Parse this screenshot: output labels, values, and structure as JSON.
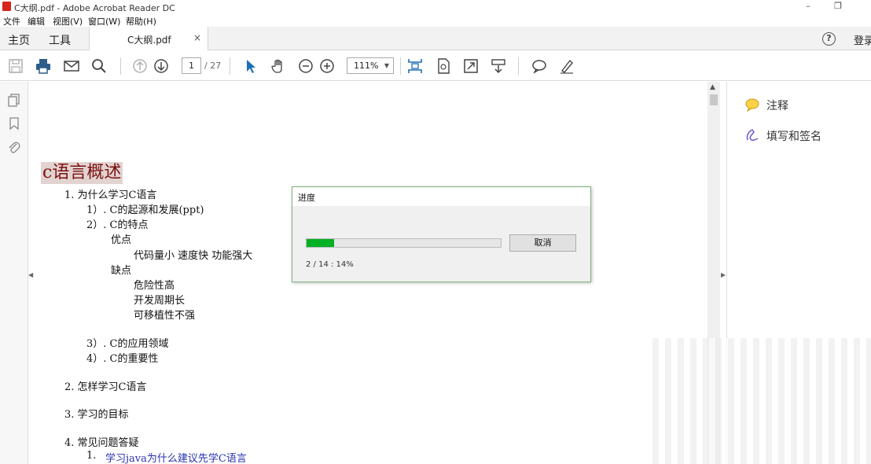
{
  "window": {
    "title": "C大纲.pdf - Adobe Acrobat Reader DC",
    "minimize": "–",
    "restore": "❐"
  },
  "menu": [
    "文件",
    "编辑",
    "视图(V)",
    "窗口(W)",
    "帮助(H)"
  ],
  "tabs": {
    "home": "主页",
    "tools": "工具",
    "document": "C大纲.pdf",
    "close": "×",
    "help": "?",
    "login": "登录"
  },
  "toolbar": {
    "page_current": "1",
    "page_total": "/ 27",
    "zoom": "111%",
    "zoom_caret": "▼"
  },
  "document": {
    "heading": "c语言概述",
    "lines": [
      "1.  为什么学习C语言",
      "1）. C的起源和发展(ppt)",
      "2）. C的特点",
      "优点",
      "代码量小      速度快      功能强大",
      "缺点",
      "危险性高",
      "开发周期长",
      "可移植性不强",
      "3）. C的应用领域",
      "4）. C的重要性",
      "2.  怎样学习C语言",
      "3.  学习的目标",
      "4.  常见问题答疑",
      "1.  ",
      "学习java为什么建议先学C语言"
    ]
  },
  "scroll": {
    "up": "▲",
    "collapse_left": "◀",
    "collapse_right": "▶"
  },
  "right_pane": {
    "comment": "注释",
    "fill_sign": "填写和签名"
  },
  "dialog": {
    "title": "进度",
    "cancel": "取消",
    "status": "2 / 14 : 14%",
    "progress": 0.14,
    "progress_color": "#06b025"
  },
  "colors": {
    "heading_bg": "#e2d3d0",
    "heading_text": "#7a1010",
    "link_text": "#2a33b0",
    "accent_blue": "#1f6fb5"
  }
}
